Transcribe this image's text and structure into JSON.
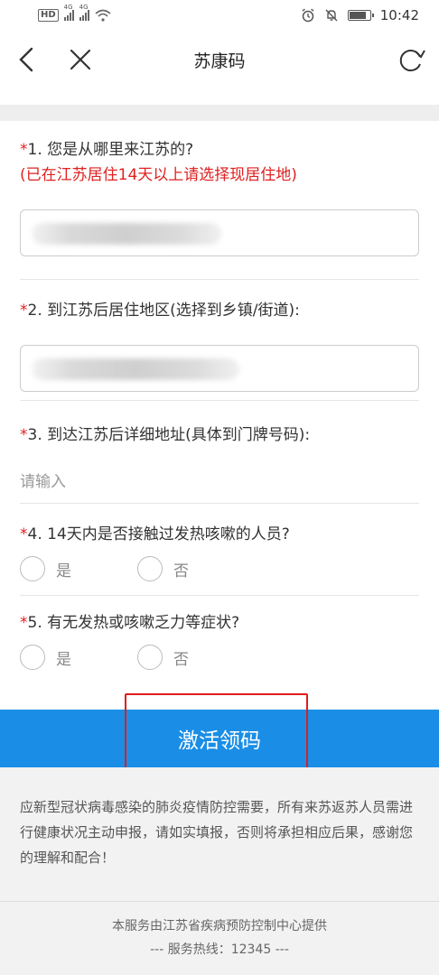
{
  "statusbar": {
    "hd_badge": "HD",
    "sim1_tag": "4G",
    "sim2_tag": "4G",
    "time": "10:42"
  },
  "navbar": {
    "title": "苏康码"
  },
  "form": {
    "required_mark": "*",
    "q1": {
      "label": "1. 您是从哪里来江苏的?",
      "note": "(已在江苏居住14天以上请选择现居住地)"
    },
    "q2": {
      "label": "2. 到江苏后居住地区(选择到乡镇/街道):"
    },
    "q3": {
      "label": "3. 到达江苏后详细地址(具体到门牌号码):",
      "placeholder": "请输入"
    },
    "q4": {
      "label": "4. 14天内是否接触过发热咳嗽的人员?",
      "yes": "是",
      "no": "否"
    },
    "q5": {
      "label": "5. 有无发热或咳嗽乏力等症状?",
      "yes": "是",
      "no": "否"
    }
  },
  "activate_button": {
    "label": "激活领码"
  },
  "footer": {
    "notice": "应新型冠状病毒感染的肺炎疫情防控需要，所有来苏返苏人员需进行健康状况主动申报，请如实填报，否则将承担相应后果，感谢您的理解和配合！",
    "provider": "本服务由江苏省疾病预防控制中心提供",
    "hotline": "--- 服务热线：12345 ---"
  },
  "colors": {
    "accent": "#1a8ee6",
    "required": "#e02020",
    "highlight_box": "#e01c1c",
    "footer_bg": "#f2f2f2"
  },
  "icons": {
    "back": "chevron-left-icon",
    "close": "close-icon",
    "refresh": "refresh-icon",
    "alarm": "alarm-icon",
    "mute": "bell-off-icon",
    "wifi": "wifi-icon",
    "battery": "battery-icon"
  },
  "battery_level_percent": 85
}
